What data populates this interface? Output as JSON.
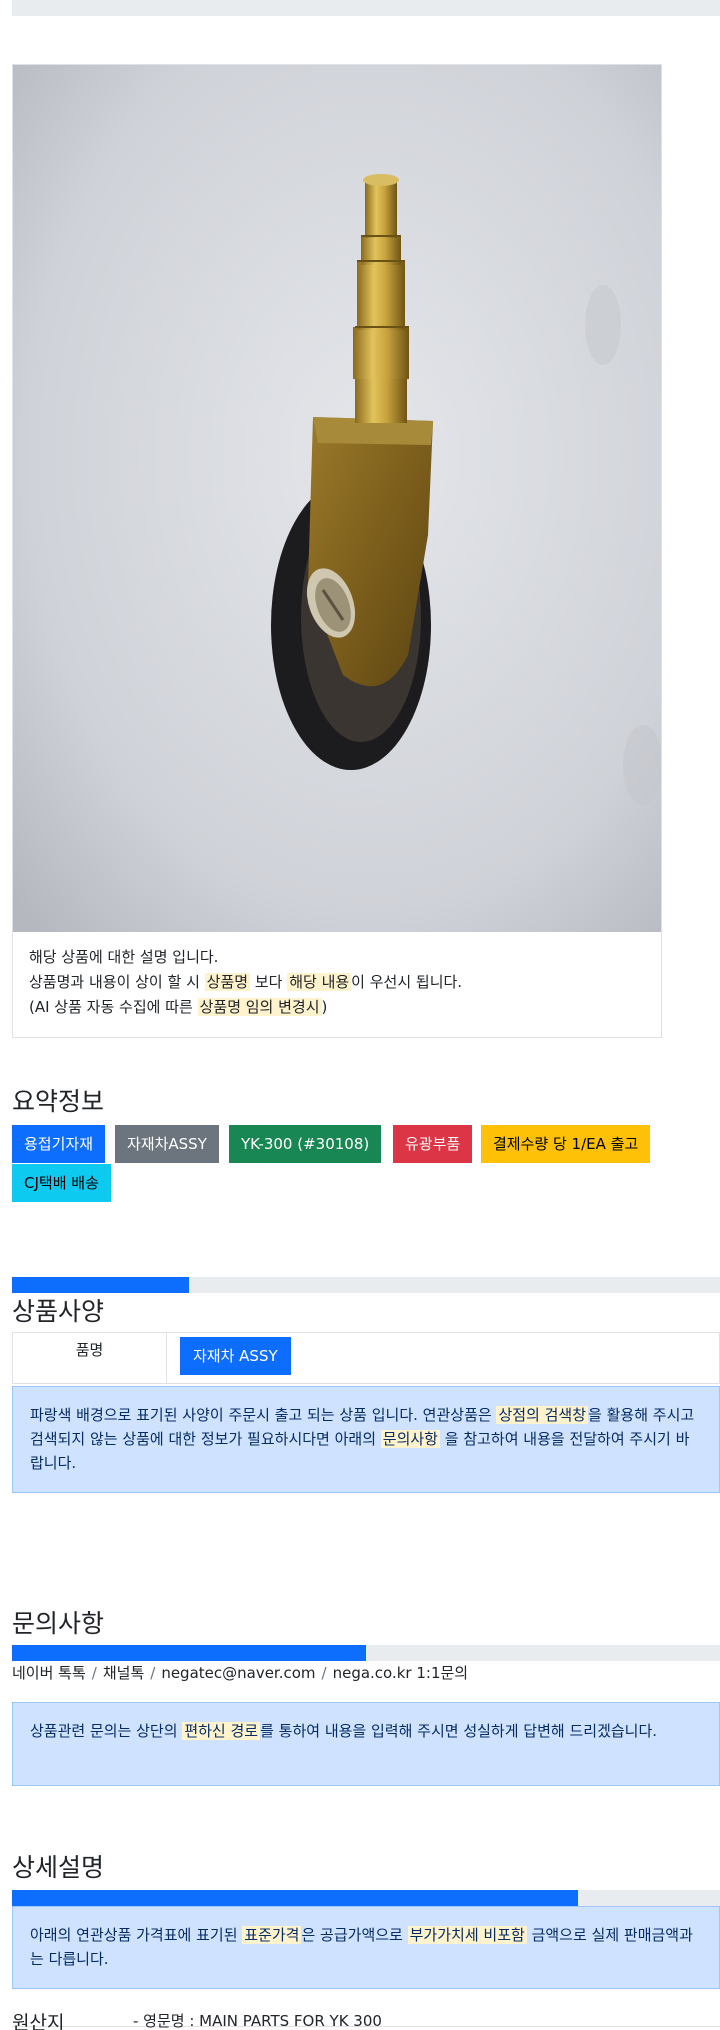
{
  "card": {
    "desc_line1": "해당 상품에 대한 설명 입니다.",
    "desc_line2_a": "상품명과 내용이 상이 할 시 ",
    "desc_line2_hl1": "상품명",
    "desc_line2_b": " 보다 ",
    "desc_line2_hl2": "해당 내용",
    "desc_line2_c": "이 우선시 됩니다.",
    "desc_line3_a": "(AI 상품 자동 수집에 따른 ",
    "desc_line3_hl": "상품명 임의 변경시",
    "desc_line3_b": ")"
  },
  "summary": {
    "title": "요약정보",
    "badges": [
      "용접기자재",
      "자재차ASSY",
      "YK-300 (#30108)",
      "유광부품",
      "결제수량 당 1/EA 출고",
      "CJ택배 배송"
    ]
  },
  "spec": {
    "title": "상품사양",
    "progress_fraction": 0.25,
    "row_head": "품명",
    "row_value": "자재차 ASSY",
    "notice_a": "파랑색 배경으로 표기된 사양이 주문시 출고 되는 상품 입니다. 연관상품은 ",
    "notice_hl1": "상점의 검색창",
    "notice_b": "을 활용해 주시고 검색되지 않는 상품에 대한 정보가 필요하시다면 아래의 ",
    "notice_hl2": "문의사항",
    "notice_c": " 을 참고하여 내용을 전달하여 주시기 바랍니다."
  },
  "inquiry": {
    "title": "문의사항",
    "progress_fraction": 0.5,
    "channels": [
      "네이버 톡톡",
      "채널톡",
      "negatec@naver.com",
      "nega.co.kr 1:1문의"
    ],
    "separator": "/",
    "notice_a": "상품관련 문의는 상단의 ",
    "notice_hl": "편하신 경로",
    "notice_b": "를 통하여 내용을 입력해 주시면 성실하게 답변해 드리겠습니다."
  },
  "detail": {
    "title": "상세설명",
    "progress_fraction": 0.8,
    "notice_a": "아래의 연관상품 가격표에 표기된 ",
    "notice_hl1": "표준가격",
    "notice_b": "은 공급가액으로 ",
    "notice_hl2": "부가가치세 비포함",
    "notice_c": " 금액으로 실제 판매금액과는 다릅니다."
  },
  "origin": {
    "label": "원산지",
    "value": "- 영문명 : MAIN PARTS FOR YK 300"
  },
  "colors": {
    "primary": "#0d6efd",
    "secondary": "#6c757d",
    "success": "#198754",
    "danger": "#dc3545",
    "warning": "#ffc107",
    "info": "#0dcaf0",
    "alert_bg": "#cfe2ff",
    "highlight": "#fff3cd"
  }
}
